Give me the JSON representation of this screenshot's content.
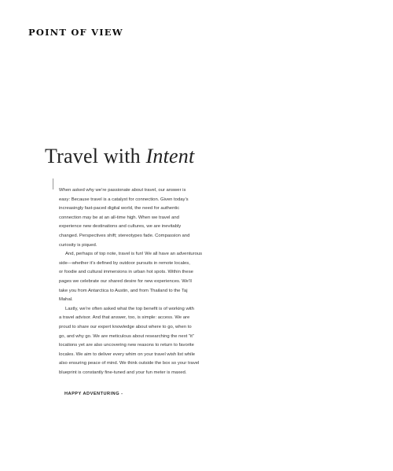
{
  "section_label": "POINT OF VIEW",
  "title": {
    "main": "Travel with ",
    "emphasis": "Intent"
  },
  "paragraphs": [
    {
      "lines": [
        "When asked why we’re passionate about travel, our answer is",
        "easy: Because travel is a catalyst for connection. Given today’s",
        "increasingly fast-paced digital world, the need for authentic",
        "connection may be at an all-time high. When we travel and",
        "experience new destinations and cultures, we are inevitably",
        "changed. Perspectives shift; stereotypes fade. Compassion and",
        "curiosity is piqued."
      ]
    },
    {
      "lines": [
        "And, perhaps of top note, travel is fun! We all have an adventurous",
        "side—whether it’s defined by outdoor pursuits in remote locales,",
        "or foodie and cultural immersions in urban hot spots. Within these",
        "pages we celebrate our shared desire for new experiences. We’ll",
        "take you from Antarctica to Austin, and from Thailand to the Taj",
        "Mahal."
      ]
    },
    {
      "lines": [
        "Lastly, we’re often asked what the top benefit is of working with",
        "a travel advisor. And that answer, too, is simple: access. We are",
        "proud to share our expert knowledge about where to go, when to",
        "go, and why go. We are meticulous about researching the next “it”",
        "locations yet are also uncovering new reasons to return to favorite",
        "locales. We aim to deliver every whim on your travel wish list while",
        "also ensuring peace of mind. We think outside the box so your travel",
        "blueprint is constantly fine-tuned and your fun meter is maxed."
      ]
    }
  ],
  "signoff": "HAPPY ADVENTURING -"
}
